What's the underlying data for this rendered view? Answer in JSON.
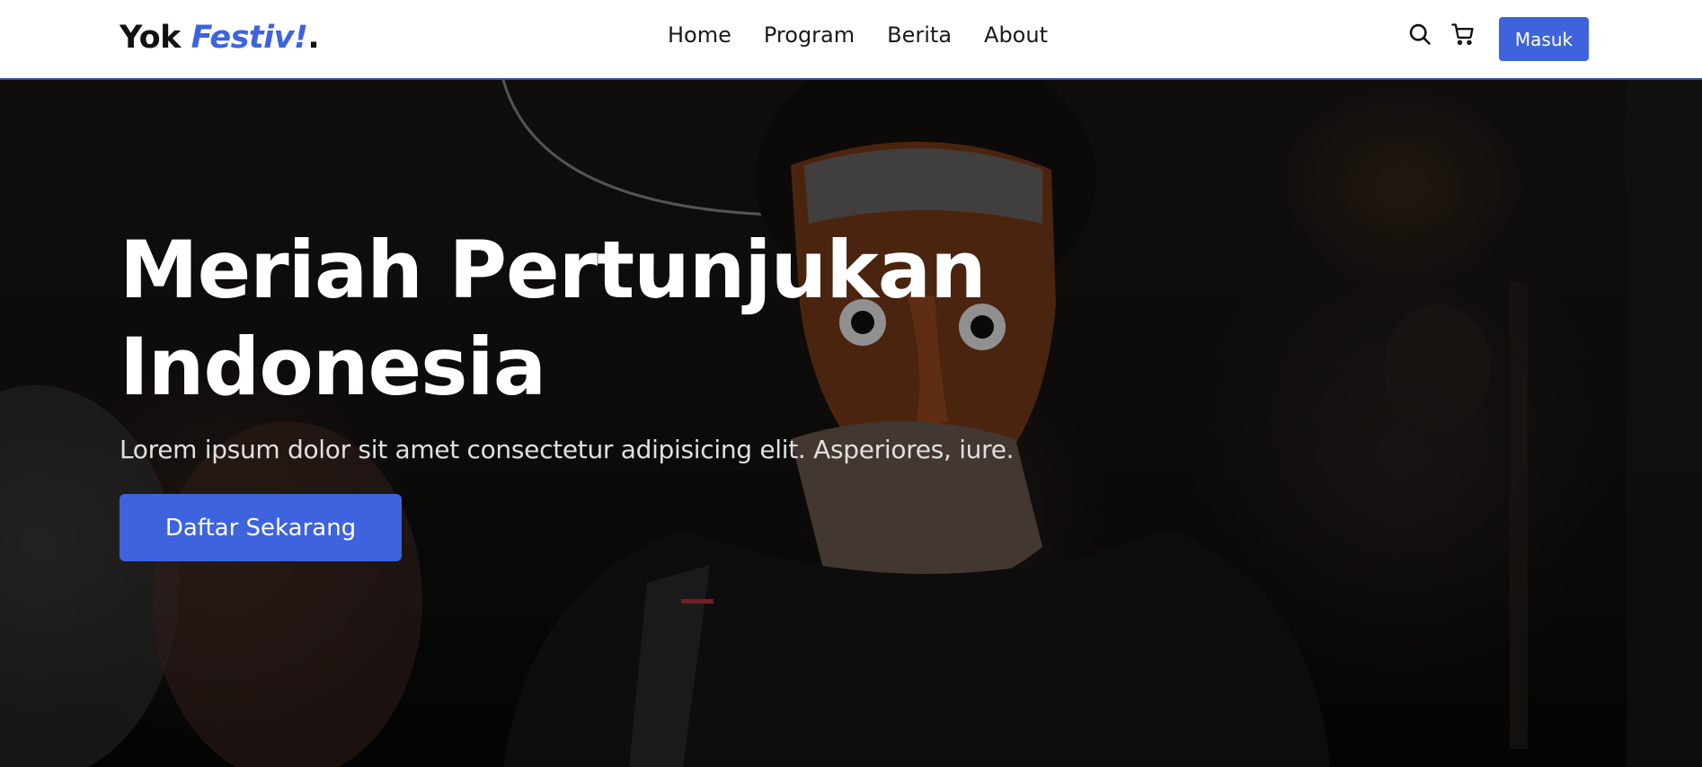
{
  "brand": {
    "logo_prefix": "Yok ",
    "logo_accent": "Festiv!",
    "logo_suffix": ".",
    "accent_color": "#3e63dd"
  },
  "nav": {
    "links": [
      "Home",
      "Program",
      "Berita",
      "About"
    ],
    "icons": [
      "search-icon",
      "cart-icon"
    ],
    "login_label": "Masuk"
  },
  "hero": {
    "title_line1": "Meriah Pertunjukan",
    "title_line2": "Indonesia",
    "subtitle": "Lorem ipsum dolor sit amet consectetur adipisicing elit. Asperiores, iure.",
    "cta_label": "Daftar Sekarang"
  }
}
